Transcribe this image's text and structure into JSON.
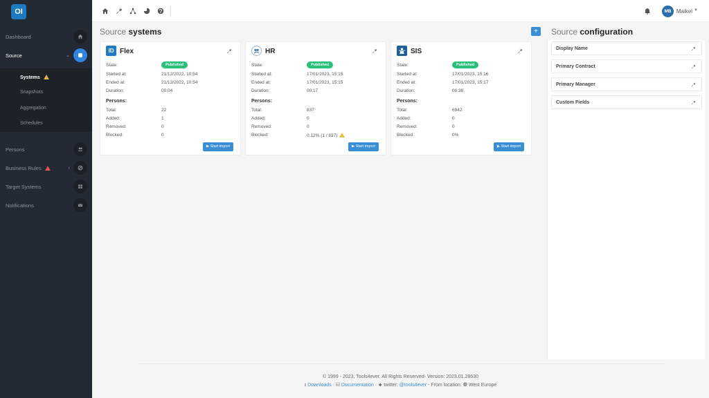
{
  "app": {
    "logo_text": "OI"
  },
  "sidebar": {
    "items": [
      {
        "label": "Dashboard"
      },
      {
        "label": "Source"
      },
      {
        "label": "Persons"
      },
      {
        "label": "Business Rules"
      },
      {
        "label": "Target Systems"
      },
      {
        "label": "Notifications"
      }
    ],
    "source_sub": [
      {
        "label": "Systems"
      },
      {
        "label": "Snapshots"
      },
      {
        "label": "Aggregation"
      },
      {
        "label": "Schedules"
      }
    ]
  },
  "topbar": {
    "user_initials": "MB",
    "user_name": "Maikel"
  },
  "systems": {
    "title_light": "Source",
    "title_bold": "systems",
    "labels": {
      "state": "State:",
      "started": "Started at:",
      "ended": "Ended at:",
      "duration": "Duration:",
      "persons": "Persons:",
      "total": "Total:",
      "added": "Added:",
      "removed": "Removed:",
      "blocked": "Blocked:",
      "start_import": "▶ Start import"
    },
    "cards": [
      {
        "name": "Flex",
        "icon_text": "ID",
        "state": "Published",
        "started": "21/12/2022, 10:54",
        "ended": "21/12/2022, 10:54",
        "duration": "00:04",
        "total": "22",
        "added": "1",
        "removed": "0",
        "blocked": "0"
      },
      {
        "name": "HR",
        "icon_text": "",
        "state": "Published",
        "started": "17/01/2023, 15:15",
        "ended": "17/01/2023, 15:15",
        "duration": "00:17",
        "total": "837",
        "added": "0",
        "removed": "0",
        "blocked": "0.12% (1 / 837)"
      },
      {
        "name": "SIS",
        "icon_text": "",
        "state": "Published",
        "started": "17/01/2023, 15:16",
        "ended": "17/01/2023, 15:17",
        "duration": "00:38",
        "total": "6942",
        "added": "0",
        "removed": "0",
        "blocked": "0%"
      }
    ]
  },
  "config": {
    "title_light": "Source",
    "title_bold": "configuration",
    "items": [
      {
        "label": "Display Name"
      },
      {
        "label": "Primary Contract"
      },
      {
        "label": "Primary Manager"
      },
      {
        "label": "Custom Fields"
      }
    ]
  },
  "footer": {
    "line1": "© 1999 - 2023, Tools4ever. All Rights Reserved- Version: 2023.01.28630",
    "downloads": "Downloads",
    "documentation": "Documentation",
    "twitter_prefix": "twitter:",
    "twitter_handle": "@tools4ever",
    "location_prefix": "- From location:",
    "location": "West Europe"
  },
  "colors": {
    "accent": "#3a8ed6",
    "published": "#29c07a",
    "sidebar": "#242a33"
  }
}
